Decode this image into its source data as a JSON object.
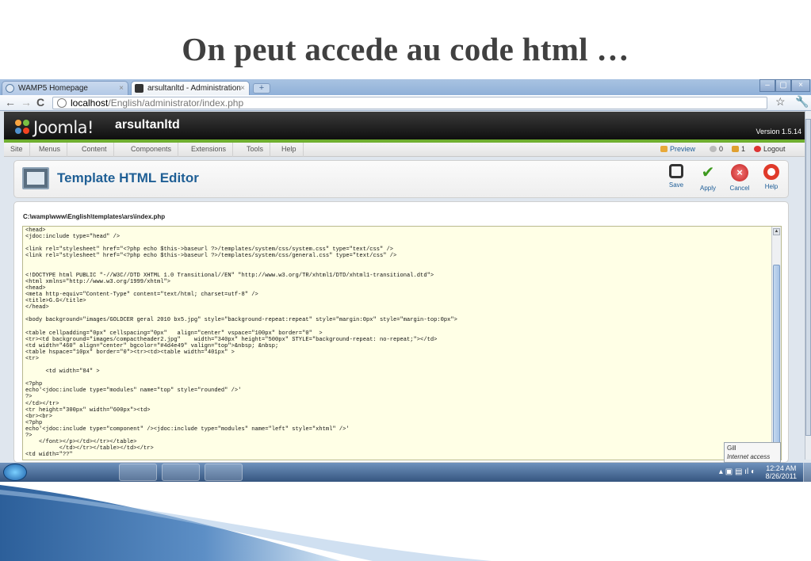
{
  "slide": {
    "title": "On peut accede au code html …"
  },
  "browser": {
    "tabs": [
      {
        "label": "WAMP5 Homepage",
        "icon": "globe-icon"
      },
      {
        "label": "arsultanltd - Administration",
        "icon": "joomla-icon"
      }
    ],
    "new_tab_symbol": "+",
    "window_controls": [
      "–",
      "▢",
      "×"
    ],
    "url_host": "localhost",
    "url_path": "/English/administrator/index.php"
  },
  "joomla": {
    "logo_text": "Joomla!",
    "site_name": "arsultanltd",
    "version": "Version 1.5.14",
    "menu": [
      "Site",
      "Menus",
      "Content",
      "Components",
      "Extensions",
      "Tools",
      "Help"
    ],
    "status": {
      "preview": "Preview",
      "visitors": "0",
      "admins": "1",
      "logout": "Logout"
    },
    "page_title": "Template HTML Editor",
    "toolbar_buttons": [
      {
        "label": "Save",
        "icon": "save-icon",
        "color": "#333333"
      },
      {
        "label": "Apply",
        "icon": "apply-check-icon",
        "color": "#3e9a1f"
      },
      {
        "label": "Cancel",
        "icon": "cancel-icon",
        "color": "#d62f2f"
      },
      {
        "label": "Help",
        "icon": "help-lifebuoy-icon",
        "color": "#e03a2a"
      }
    ],
    "file_path": "C:\\wamp\\www\\English\\templates\\ars\\index.php",
    "code_lines": [
      "<head>",
      "<jdoc:include type=\"head\" />",
      "",
      "<link rel=\"stylesheet\" href=\"<?php echo $this->baseurl ?>/templates/system/css/system.css\" type=\"text/css\" />",
      "<link rel=\"stylesheet\" href=\"<?php echo $this->baseurl ?>/templates/system/css/general.css\" type=\"text/css\" />",
      "",
      "",
      "<!DOCTYPE html PUBLIC \"-//W3C//DTD XHTML 1.0 Transitional//EN\" \"http://www.w3.org/TR/xhtml1/DTD/xhtml1-transitional.dtd\">",
      "<html xmlns=\"http://www.w3.org/1999/xhtml\">",
      "<head>",
      "<meta http-equiv=\"Content-Type\" content=\"text/html; charset=utf-8\" />",
      "<title>G.G</title>",
      "</head>",
      "",
      "<body background=\"images/GOLDCER geral 2010 bx5.jpg\" style=\"background-repeat:repeat\" style=\"margin:0px\" style=\"margin-top:0px\">",
      "",
      "<table cellpadding=\"0px\" cellspacing=\"0px\"   align=\"center\" vspace=\"100px\" border=\"0\"  >",
      "<tr><td background=\"images/compactheader2.jpg\"    width=\"340px\" height=\"500px\" STYLE=\"background-repeat: no-repeat;\"></td>",
      "<td width=\"460\" align=\"center\" bgcolor=\"#4d4e49\" valign=\"top\">&nbsp; &nbsp;",
      "<table hspace=\"10px\" border=\"0\"><tr><td><table width=\"401px\" >",
      "<tr>",
      "",
      "      <td width=\"84\" >",
      "",
      "<?php",
      "echo'<jdoc:include type=\"modules\" name=\"top\" style=\"rounded\" />'",
      "?>",
      "</td></tr>",
      "<tr height=\"300px\" width=\"600px\"><td>",
      "<br><br>",
      "<?php",
      "echo'<jdoc:include type=\"component\" /><jdoc:include type=\"modules\" name=\"left\" style=\"xhtml\" />'",
      "?>",
      "    </font></p></td></tr></table>",
      "          </td></tr></table></td></tr>",
      "<td width=\"??\""
    ]
  },
  "tooltip": {
    "line1": "Gill",
    "line2": "Internet access"
  },
  "taskbar": {
    "apps": [
      {
        "name": "internet-explorer-icon",
        "color": "#2f7fd0"
      },
      {
        "name": "folder-icon",
        "color": "#e8c65a"
      },
      {
        "name": "media-center-icon",
        "color": "#4a9a3a"
      },
      {
        "name": "chrome-icon",
        "color": "#d94a3a"
      },
      {
        "name": "paint-icon",
        "color": "#9fb5cf"
      }
    ],
    "time": "12:24 AM",
    "date": "8/26/2011"
  }
}
